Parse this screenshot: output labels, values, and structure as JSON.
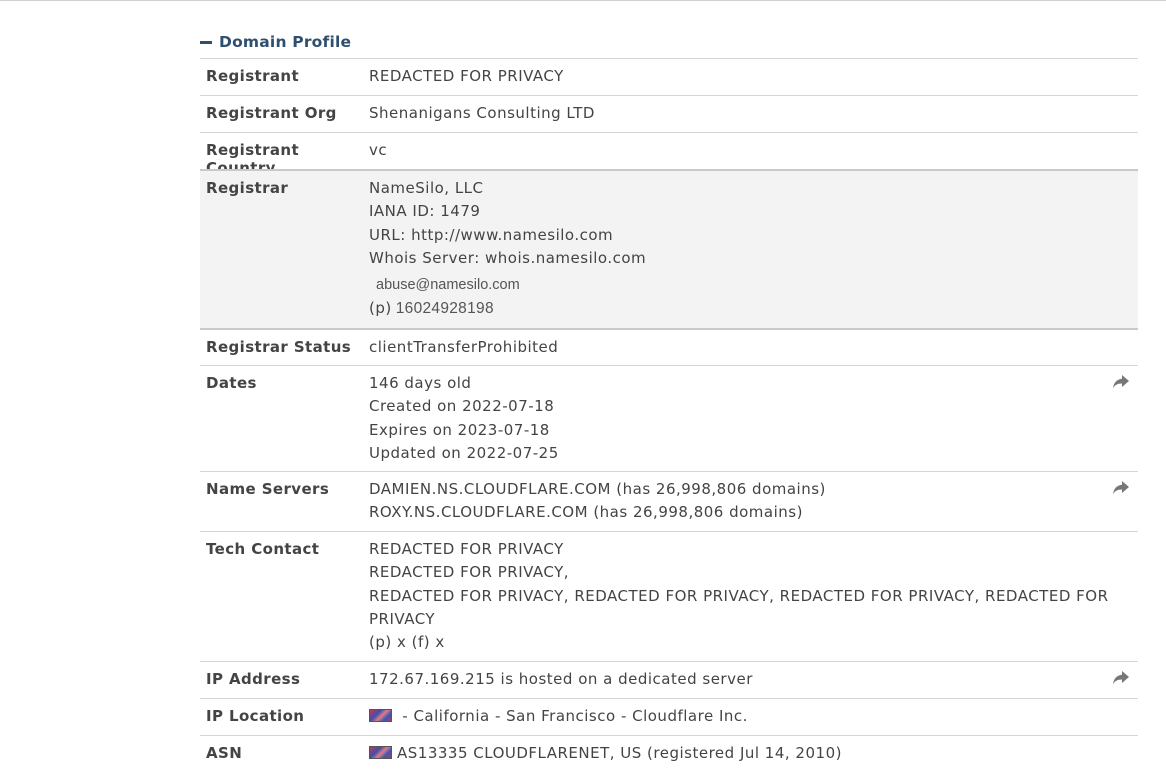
{
  "section": {
    "title": "Domain Profile"
  },
  "rows": {
    "registrant": {
      "label": "Registrant",
      "value": "REDACTED FOR PRIVACY"
    },
    "registrant_org": {
      "label": "Registrant Org",
      "value": "Shenanigans Consulting LTD"
    },
    "registrant_country": {
      "label": "Registrant Country",
      "value": "vc"
    },
    "registrar": {
      "label": "Registrar",
      "lines": [
        "NameSilo, LLC",
        "IANA ID: 1479",
        "URL: http://www.namesilo.com",
        "Whois Server: whois.namesilo.com"
      ],
      "email": "abuse@namesilo.com",
      "phone_prefix": "(p)",
      "phone": "16024928198"
    },
    "registrar_status": {
      "label": "Registrar Status",
      "value": "clientTransferProhibited"
    },
    "dates": {
      "label": "Dates",
      "lines": [
        "146 days old",
        "Created on 2022-07-18",
        "Expires on 2023-07-18",
        "Updated on 2022-07-25"
      ]
    },
    "name_servers": {
      "label": "Name Servers",
      "lines": [
        "DAMIEN.NS.CLOUDFLARE.COM (has 26,998,806 domains)",
        "ROXY.NS.CLOUDFLARE.COM (has 26,998,806 domains)"
      ]
    },
    "tech_contact": {
      "label": "Tech Contact",
      "lines": [
        "REDACTED FOR PRIVACY",
        "REDACTED FOR PRIVACY,",
        "REDACTED FOR PRIVACY, REDACTED FOR PRIVACY, REDACTED FOR PRIVACY, REDACTED FOR PRIVACY",
        "(p) x  (f) x"
      ]
    },
    "ip_address": {
      "label": "IP Address",
      "value": "172.67.169.215 is hosted on a dedicated server"
    },
    "ip_location": {
      "label": "IP Location",
      "value": " - California - San Francisco - Cloudflare Inc."
    },
    "asn": {
      "label": "ASN",
      "value": "AS13335 CLOUDFLARENET, US (registered Jul 14, 2010)"
    }
  },
  "icons": {
    "share": "share-arrow-icon",
    "flag": "us-flag-icon"
  },
  "colors": {
    "header": "#2f4f6f",
    "text": "#444444",
    "shaded_row": "#f3f3f3"
  }
}
